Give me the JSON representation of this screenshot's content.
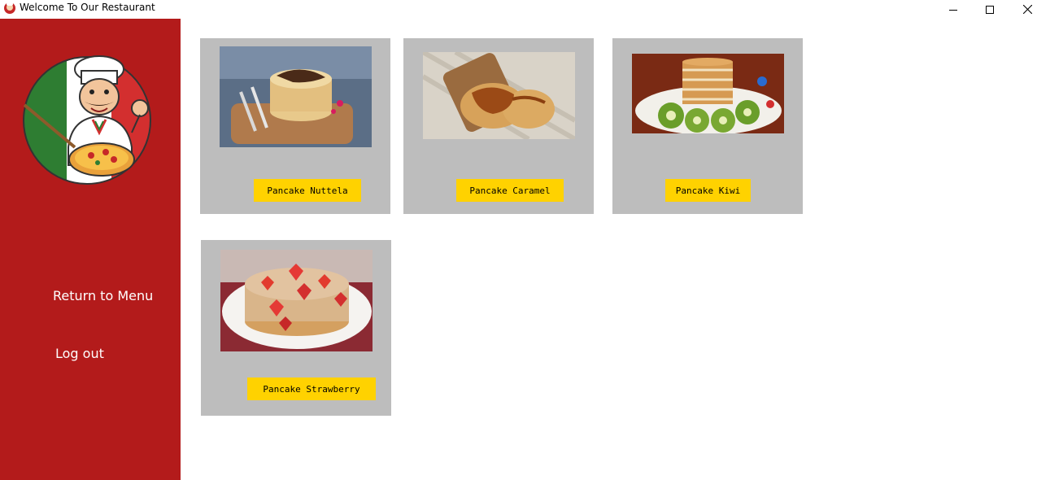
{
  "window": {
    "title": "Welcome To Our Restaurant",
    "controls": [
      "minimize",
      "maximize",
      "close"
    ]
  },
  "sidebar": {
    "logo_icon": "chef-pizza-logo",
    "links": [
      {
        "label": "Return to Menu"
      },
      {
        "label": "Log out"
      }
    ]
  },
  "products": [
    {
      "label": "Pancake Nuttela",
      "image": "pancake-nutella-photo"
    },
    {
      "label": "Pancake Caramel",
      "image": "pancake-caramel-photo"
    },
    {
      "label": "Pancake Kiwi",
      "image": "pancake-kiwi-photo"
    },
    {
      "label": "Pancake Strawberry",
      "image": "pancake-strawberry-photo"
    }
  ],
  "colors": {
    "sidebar": "#b31b1b",
    "card": "#bdbdbd",
    "button": "#ffd200"
  }
}
